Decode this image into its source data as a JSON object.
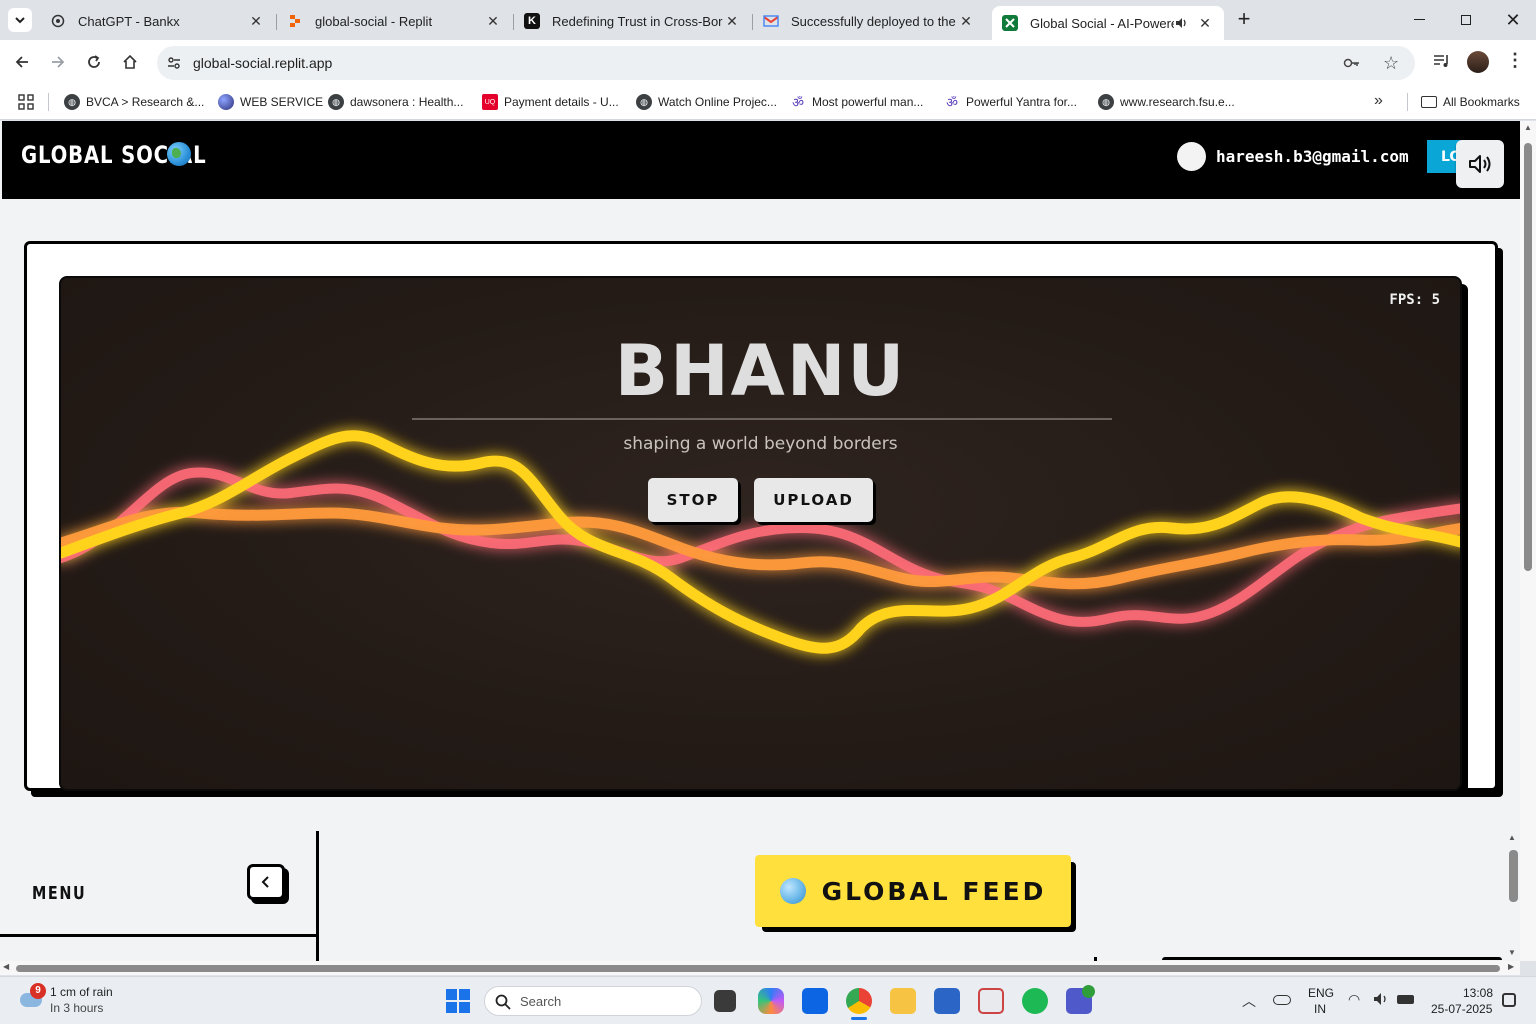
{
  "browser": {
    "tabs": [
      {
        "title": "ChatGPT - Bankx",
        "favicon": "openai-icon"
      },
      {
        "title": "global-social - Replit",
        "favicon": "replit-icon"
      },
      {
        "title": "Redefining Trust in Cross-Borde",
        "favicon": "k-icon"
      },
      {
        "title": "Successfully deployed to the fo",
        "favicon": "gmail-icon"
      },
      {
        "title": "Global Social - AI-Powered",
        "favicon": "global-social-icon",
        "active": true
      }
    ],
    "url": "global-social.replit.app",
    "bookmarks": [
      {
        "label": "BVCA > Research &...",
        "icon": "globe-icon"
      },
      {
        "label": "WEB SERVICE",
        "icon": "sphere-icon"
      },
      {
        "label": "dawsonera : Health...",
        "icon": "globe-icon"
      },
      {
        "label": "Payment details - U...",
        "icon": "uniqlo-icon"
      },
      {
        "label": "Watch Online Projec...",
        "icon": "globe-icon"
      },
      {
        "label": "Most powerful man...",
        "icon": "om-icon"
      },
      {
        "label": "Powerful Yantra for...",
        "icon": "om-icon"
      },
      {
        "label": "www.research.fsu.e...",
        "icon": "globe-icon"
      }
    ],
    "all_bookmarks": "All Bookmarks"
  },
  "site": {
    "brand": "GLOBAL SOCIAL",
    "user_email": "hareesh.b3@gmail.com",
    "logout_label": "LOGOUT",
    "hero": {
      "fps_label": "FPS: 5",
      "title": "BHANU",
      "tagline": "shaping a world beyond borders",
      "stop_label": "STOP",
      "upload_label": "UPLOAD"
    },
    "menu_label": "MENU",
    "feed_label": "GLOBAL FEED"
  },
  "taskbar": {
    "weather_badge": "9",
    "weather_line1": "1 cm of rain",
    "weather_line2": "In 3 hours",
    "search_placeholder": "Search",
    "lang_line1": "ENG",
    "lang_line2": "IN",
    "time": "13:08",
    "date": "25-07-2025"
  },
  "colors": {
    "logout_accent": "#0aa6d6",
    "feed_accent": "#ffe03d",
    "header_bg": "#000000",
    "wave_yellow": "#ffd21f",
    "wave_orange": "#ff9a3c",
    "wave_pink": "#ff6b78"
  }
}
